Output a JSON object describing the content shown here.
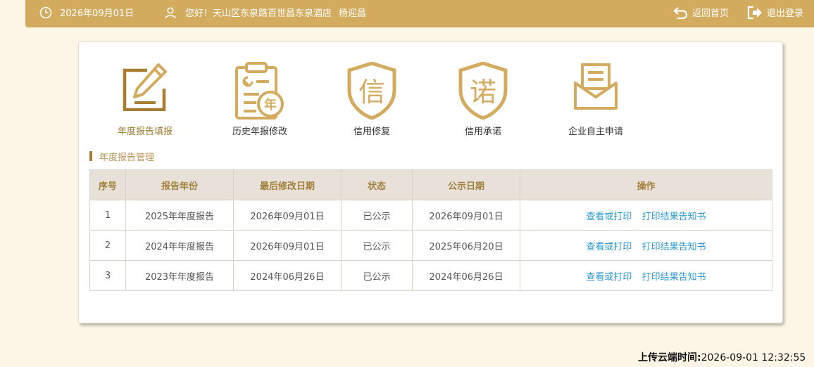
{
  "header": {
    "date": "2026年09月01日",
    "greeting": "您好！天山区东泉路百世昌东泉酒店",
    "user_name": "杨迎昌",
    "home_label": "返回首页",
    "logout_label": "退出登录"
  },
  "nav": {
    "items": [
      {
        "label": "年度报告填报",
        "icon": "edit-report-icon"
      },
      {
        "label": "历史年报修改",
        "icon": "history-report-icon",
        "badge": "年"
      },
      {
        "label": "信用修复",
        "icon": "credit-repair-shield-icon",
        "glyph": "信"
      },
      {
        "label": "信用承诺",
        "icon": "credit-promise-shield-icon",
        "glyph": "诺"
      },
      {
        "label": "企业自主申请",
        "icon": "mail-application-icon"
      }
    ],
    "active_index": 0
  },
  "section": {
    "title": "年度报告管理"
  },
  "table": {
    "headers": [
      "序号",
      "报告年份",
      "最后修改日期",
      "状态",
      "公示日期",
      "操作"
    ],
    "rows": [
      {
        "no": "1",
        "year": "2025年年度报告",
        "modified": "2026年09月01日",
        "status": "已公示",
        "public_date": "2026年09月01日",
        "action_view": "查看或打印",
        "action_print": "打印结果告知书"
      },
      {
        "no": "2",
        "year": "2024年年度报告",
        "modified": "2026年09月01日",
        "status": "已公示",
        "public_date": "2025年06月20日",
        "action_view": "查看或打印",
        "action_print": "打印结果告知书"
      },
      {
        "no": "3",
        "year": "2023年年度报告",
        "modified": "2024年06月26日",
        "status": "已公示",
        "public_date": "2024年06月26日",
        "action_view": "查看或打印",
        "action_print": "打印结果告知书"
      }
    ]
  },
  "footer": {
    "upload_label": "上传云端时间:",
    "upload_time": "2026-09-01 12:32:55"
  },
  "colors": {
    "accent": "#d3ab5f",
    "page_bg": "#fdf6e6",
    "icon_gold": "#d3ab5f",
    "icon_dark": "#a67d31",
    "link": "#2b9ad0"
  }
}
